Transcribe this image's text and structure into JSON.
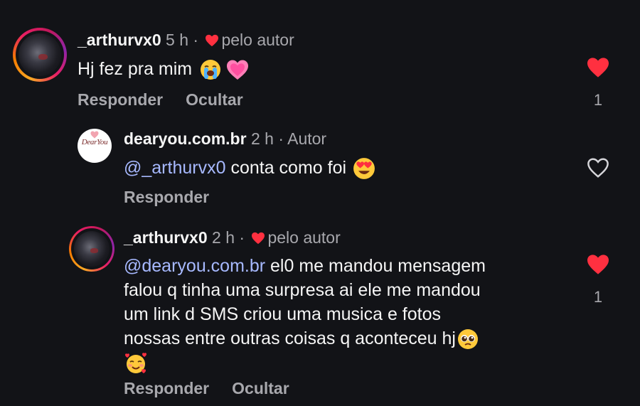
{
  "colors": {
    "background": "#121317",
    "text_primary": "#f5f5f5",
    "text_secondary": "#a8a8ad",
    "mention": "#a7b9ff",
    "like_red": "#ff3040"
  },
  "comments": [
    {
      "username": "_arthurvx0",
      "time": "5 h",
      "separator": "·",
      "liked_by_author_label": "pelo autor",
      "text": "Hj fez pra mim",
      "emojis": [
        "loudly-crying-face-emoji",
        "growing-heart-emoji"
      ],
      "reply_label": "Responder",
      "hide_label": "Ocultar",
      "liked": true,
      "like_count": "1"
    },
    {
      "username": "dearyou.com.br",
      "time": "2 h",
      "separator": "·",
      "author_label": "Autor",
      "avatar_text": "DearYou",
      "mention": "@_arthurvx0",
      "text": "conta como foi",
      "emojis": [
        "smiling-face-with-heart-eyes-emoji"
      ],
      "reply_label": "Responder",
      "liked": false
    },
    {
      "username": "_arthurvx0",
      "time": "2 h",
      "separator": "·",
      "liked_by_author_label": "pelo autor",
      "mention": "@dearyou.com.br",
      "lines": [
        "el0 me mandou mensagem",
        "falou q tinha uma surpresa ai ele me mandou",
        "um link d SMS criou uma musica e fotos",
        "nossas entre outras coisas q aconteceu hj"
      ],
      "emojis": [
        "pleading-face-emoji",
        "smiling-face-with-hearts-emoji"
      ],
      "reply_label": "Responder",
      "hide_label": "Ocultar",
      "liked": true,
      "like_count": "1"
    }
  ]
}
